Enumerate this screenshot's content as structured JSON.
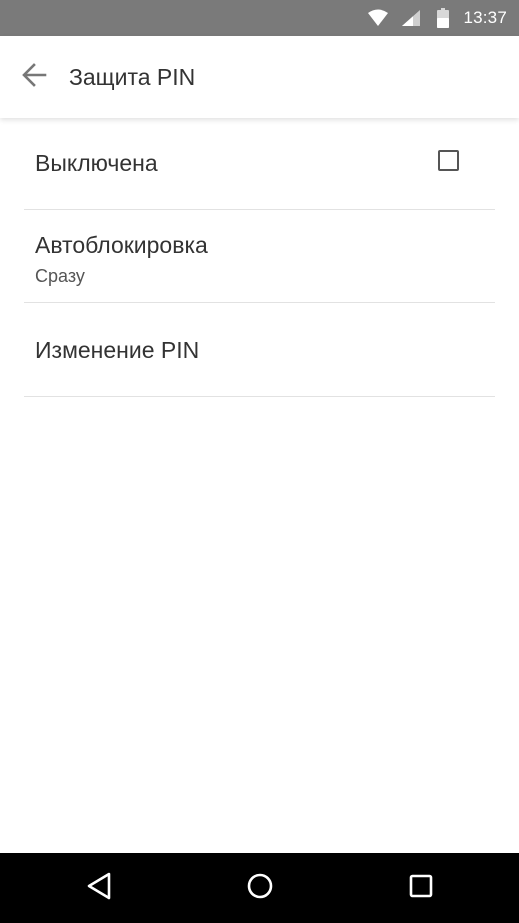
{
  "status_bar": {
    "time": "13:37",
    "icons": [
      "wifi-icon",
      "cell-signal-icon",
      "battery-icon"
    ]
  },
  "app_bar": {
    "title": "Защита PIN",
    "back_icon": "arrow-back-icon"
  },
  "settings": {
    "items": [
      {
        "label": "Выключена",
        "checked": false
      },
      {
        "label": "Автоблокировка",
        "summary": "Сразу"
      },
      {
        "label": "Изменение PIN"
      }
    ]
  },
  "nav_bar": {
    "icons": [
      "nav-back-icon",
      "nav-home-icon",
      "nav-recents-icon"
    ]
  },
  "colors": {
    "status_bar_bg": "#7a7a7a",
    "nav_bar_bg": "#000000",
    "text_primary": "#333333",
    "divider": "#e2e2e2"
  }
}
